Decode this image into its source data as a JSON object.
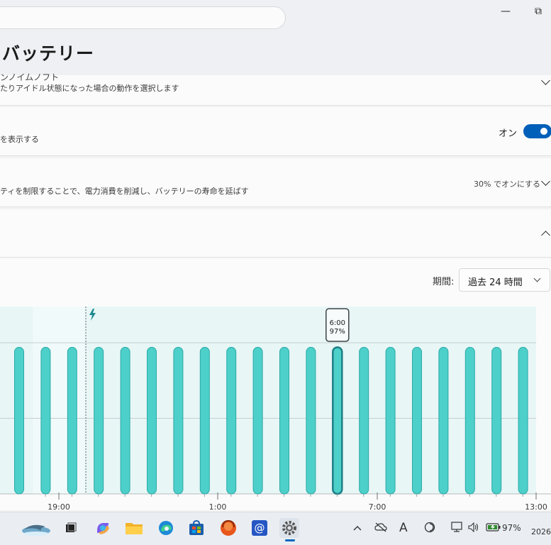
{
  "header": {
    "title": "バッテリー",
    "minimize_glyph": "—",
    "restore_glyph": "⧉"
  },
  "cards": {
    "sleep": {
      "label_partial": "ンノイムノフト",
      "description": "たりアイドル状態になった場合の動作を選択します"
    },
    "percentage": {
      "description": "を表示する",
      "toggle_label": "オン",
      "toggle_on": true
    },
    "saver": {
      "description": "ティを制限することで、電力消費を削減し、バッテリーの寿命を延ばす",
      "value": "30% でオンにする"
    }
  },
  "usage": {
    "period_label": "期間:",
    "period_value": "過去 24 時間"
  },
  "chart_data": {
    "type": "bar",
    "y_unit": "%",
    "ylim": [
      0,
      100
    ],
    "tooltip": {
      "time": "6:00",
      "value": "97%"
    },
    "x_ticks": [
      "19:00",
      "1:00",
      "7:00",
      "13:00"
    ],
    "charging_marker": true,
    "values": [
      97,
      97,
      97,
      97,
      97,
      97,
      97,
      97,
      97,
      97,
      97,
      97,
      97,
      97,
      97,
      97,
      97,
      97,
      97,
      97
    ],
    "highlight_index": 12,
    "colors": {
      "bar": "#4dd0c9",
      "bar_stroke": "#2aa9a8",
      "highlight_stroke": "#1d7f86",
      "band": "#e8f6f6"
    }
  },
  "taskbar": {
    "battery_text": "97%",
    "date_partial": "2026/"
  }
}
